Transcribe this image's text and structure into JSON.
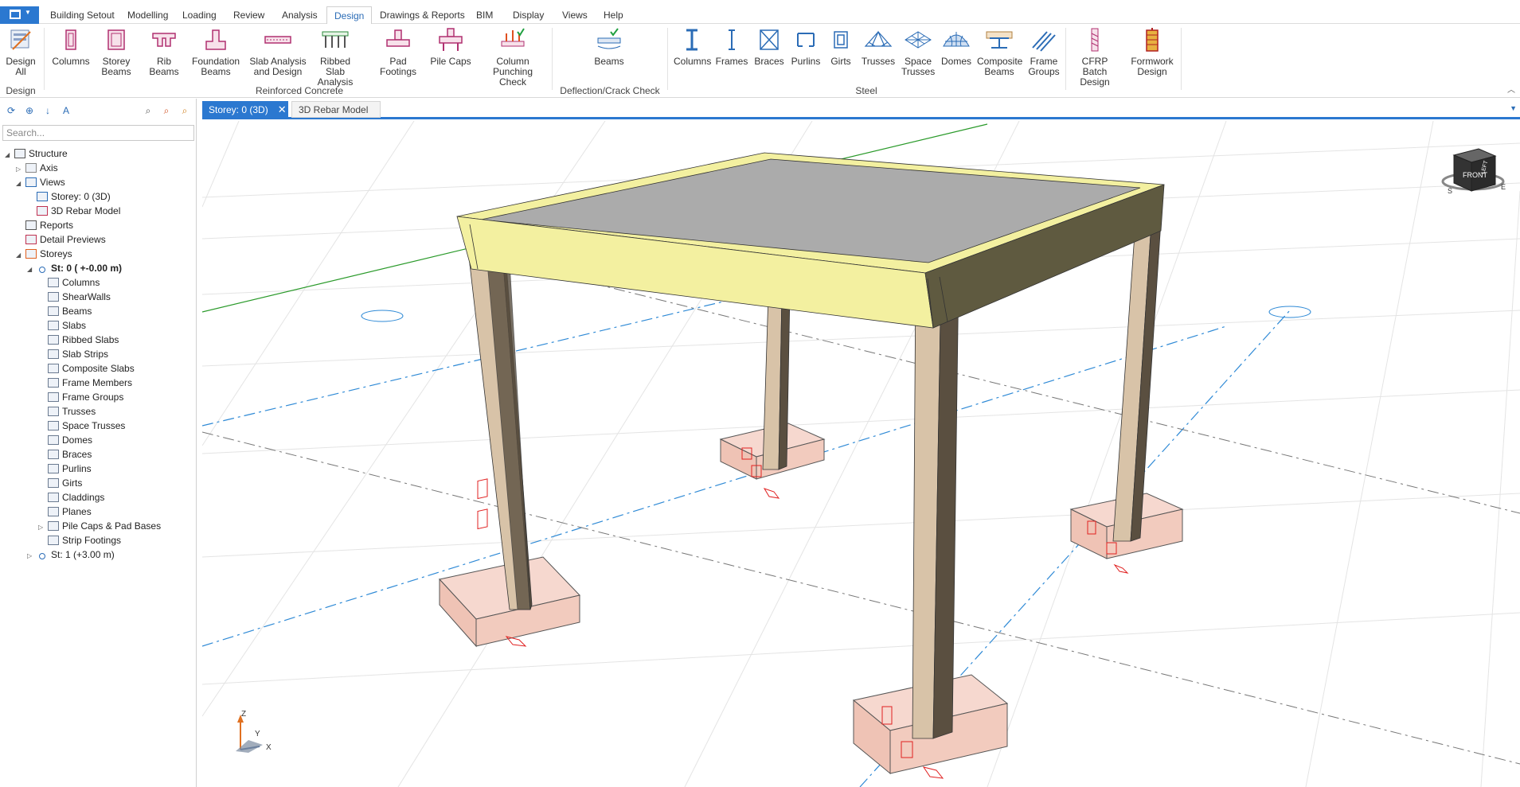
{
  "menu": {
    "tabs": [
      "Building Setout",
      "Modelling",
      "Loading",
      "Review",
      "Analysis",
      "Design",
      "Drawings & Reports",
      "BIM",
      "Display",
      "Views",
      "Help"
    ],
    "active_tab": "Design"
  },
  "ribbon": {
    "buttons": [
      {
        "label": "Design All",
        "icon": "design-all-icon"
      },
      {
        "label": "Columns",
        "icon": "rc-columns-icon"
      },
      {
        "label": "Storey Beams",
        "icon": "storey-beams-icon"
      },
      {
        "label": "Rib Beams",
        "icon": "rib-beams-icon"
      },
      {
        "label": "Foundation Beams",
        "icon": "foundation-beams-icon"
      },
      {
        "label": "Slab Analysis and Design",
        "icon": "slab-analysis-icon"
      },
      {
        "label": "Ribbed Slab Analysis",
        "icon": "ribbed-slab-icon"
      },
      {
        "label": "Pad Footings",
        "icon": "pad-footings-icon"
      },
      {
        "label": "Pile Caps",
        "icon": "pile-caps-icon"
      },
      {
        "label": "Column Punching Check",
        "icon": "punching-check-icon"
      },
      {
        "label": "Beams",
        "icon": "deflection-beams-icon"
      },
      {
        "label": "Columns",
        "icon": "steel-columns-icon"
      },
      {
        "label": "Frames",
        "icon": "frames-icon"
      },
      {
        "label": "Braces",
        "icon": "braces-icon"
      },
      {
        "label": "Purlins",
        "icon": "purlins-icon"
      },
      {
        "label": "Girts",
        "icon": "girts-icon"
      },
      {
        "label": "Trusses",
        "icon": "trusses-icon"
      },
      {
        "label": "Space Trusses",
        "icon": "space-trusses-icon"
      },
      {
        "label": "Domes",
        "icon": "domes-icon"
      },
      {
        "label": "Composite Beams",
        "icon": "composite-beams-icon"
      },
      {
        "label": "Frame Groups",
        "icon": "frame-groups-icon"
      },
      {
        "label": "CFRP Batch Design",
        "icon": "cfrp-icon"
      },
      {
        "label": "Formwork Design",
        "icon": "formwork-icon"
      }
    ],
    "groups": [
      "Design",
      "Reinforced Concrete",
      "Deflection/Crack Check",
      "Steel"
    ]
  },
  "left_panel": {
    "search_placeholder": "Search...",
    "tree": [
      {
        "label": "Structure",
        "level": 0,
        "expander": "open",
        "icon": "structure-icon"
      },
      {
        "label": "Axis",
        "level": 1,
        "expander": "closed",
        "icon": "axis-icon"
      },
      {
        "label": "Views",
        "level": 1,
        "expander": "open",
        "icon": "views-icon"
      },
      {
        "label": "Storey: 0 (3D)",
        "level": 2,
        "expander": "",
        "icon": "3d-view-icon"
      },
      {
        "label": "3D Rebar Model",
        "level": 2,
        "expander": "",
        "icon": "rebar-model-icon"
      },
      {
        "label": "Reports",
        "level": 1,
        "expander": "",
        "icon": "reports-icon"
      },
      {
        "label": "Detail Previews",
        "level": 1,
        "expander": "",
        "icon": "detail-previews-icon"
      },
      {
        "label": "Storeys",
        "level": 1,
        "expander": "open",
        "icon": "storeys-icon"
      },
      {
        "label": "St: 0 ( +-0.00 m)",
        "level": 2,
        "expander": "open",
        "icon": "storey-icon",
        "bold": true
      },
      {
        "label": "Columns",
        "level": 3,
        "expander": "",
        "icon": "columns-icon"
      },
      {
        "label": "ShearWalls",
        "level": 3,
        "expander": "",
        "icon": "shearwalls-icon"
      },
      {
        "label": "Beams",
        "level": 3,
        "expander": "",
        "icon": "beams-icon"
      },
      {
        "label": "Slabs",
        "level": 3,
        "expander": "",
        "icon": "slabs-icon"
      },
      {
        "label": "Ribbed Slabs",
        "level": 3,
        "expander": "",
        "icon": "ribbed-slabs-icon"
      },
      {
        "label": "Slab Strips",
        "level": 3,
        "expander": "",
        "icon": "slab-strips-icon"
      },
      {
        "label": "Composite Slabs",
        "level": 3,
        "expander": "",
        "icon": "composite-slabs-icon"
      },
      {
        "label": "Frame Members",
        "level": 3,
        "expander": "",
        "icon": "frame-members-icon"
      },
      {
        "label": "Frame Groups",
        "level": 3,
        "expander": "",
        "icon": "frame-groups-icon"
      },
      {
        "label": "Trusses",
        "level": 3,
        "expander": "",
        "icon": "trusses-icon"
      },
      {
        "label": "Space Trusses",
        "level": 3,
        "expander": "",
        "icon": "space-trusses-icon"
      },
      {
        "label": "Domes",
        "level": 3,
        "expander": "",
        "icon": "domes-icon"
      },
      {
        "label": "Braces",
        "level": 3,
        "expander": "",
        "icon": "braces-icon"
      },
      {
        "label": "Purlins",
        "level": 3,
        "expander": "",
        "icon": "purlins-icon"
      },
      {
        "label": "Girts",
        "level": 3,
        "expander": "",
        "icon": "girts-icon"
      },
      {
        "label": "Claddings",
        "level": 3,
        "expander": "",
        "icon": "claddings-icon"
      },
      {
        "label": "Planes",
        "level": 3,
        "expander": "",
        "icon": "planes-icon"
      },
      {
        "label": "Pile Caps & Pad Bases",
        "level": 3,
        "expander": "closed",
        "icon": "pile-caps-icon"
      },
      {
        "label": "Strip Footings",
        "level": 3,
        "expander": "",
        "icon": "strip-footings-icon"
      },
      {
        "label": "St: 1 (+3.00 m)",
        "level": 2,
        "expander": "closed",
        "icon": "storey-icon"
      }
    ]
  },
  "document_tabs": [
    {
      "label": "Storey: 0 (3D)",
      "active": true
    },
    {
      "label": "3D Rebar Model",
      "active": false
    }
  ],
  "viewcube": {
    "face": "FRONT",
    "side": "LEFT",
    "compass": [
      "S",
      "E"
    ]
  },
  "axes_triad": {
    "z": "Z",
    "y": "Y",
    "x": "X"
  },
  "colors": {
    "accent": "#2b78d0",
    "beam": "#f3f0a0",
    "slab": "#ababab",
    "column": "#d8c3a8",
    "footing": "#f2c8bc",
    "rebar": "#e02020"
  }
}
